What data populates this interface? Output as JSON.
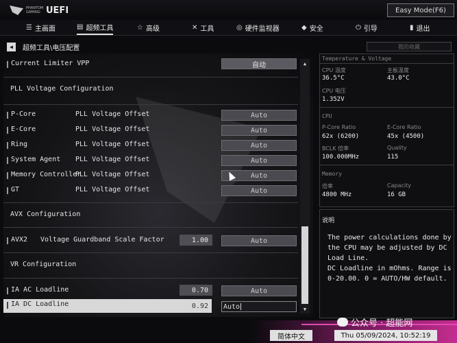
{
  "header": {
    "logo_small": "PHANTOM GAMING",
    "logo_big": "UEFI",
    "mode_button": "Easy Mode(F6)"
  },
  "nav": [
    {
      "icon": "☰",
      "label": "主画面"
    },
    {
      "icon": "▤",
      "label": "超频工具"
    },
    {
      "icon": "☆",
      "label": "高级"
    },
    {
      "icon": "✕",
      "label": "工具"
    },
    {
      "icon": "◎",
      "label": "硬件监视器"
    },
    {
      "icon": "◆",
      "label": "安全"
    },
    {
      "icon": "⏻",
      "label": "引导"
    },
    {
      "icon": "▮",
      "label": "退出"
    }
  ],
  "breadcrumb": "超频工具\\电压配置",
  "favorites": "我的收藏",
  "settings": {
    "current_limiter": {
      "label": "Current Limiter VPP",
      "value": "自动"
    },
    "pll_section": "PLL Voltage Configuration",
    "pll_rows": [
      {
        "label": "P-Core",
        "sub": "PLL Voltage Offset",
        "value": "Auto"
      },
      {
        "label": "E-Core",
        "sub": "PLL Voltage Offset",
        "value": "Auto"
      },
      {
        "label": "Ring",
        "sub": "PLL Voltage Offset",
        "value": "Auto"
      },
      {
        "label": "System Agent",
        "sub": "PLL Voltage Offset",
        "value": "Auto"
      },
      {
        "label": "Memory Controller",
        "sub": "PLL Voltage Offset",
        "value": "Auto"
      },
      {
        "label": "GT",
        "sub": "PLL Voltage Offset",
        "value": "Auto"
      }
    ],
    "avx_section": "AVX Configuration",
    "avx2": {
      "label": "AVX2",
      "sub": "Voltage Guardband Scale Factor",
      "number": "1.00",
      "value": "Auto"
    },
    "vr_section": "VR Configuration",
    "ia_ac": {
      "label": "IA AC Loadline",
      "number": "0.70",
      "value": "Auto"
    },
    "ia_dc": {
      "label": "IA DC Loadline",
      "number": "0.92",
      "value": "Auto"
    }
  },
  "info": {
    "temp_header": "Temperature & Voltage",
    "cpu_temp_label": "CPU 温度",
    "cpu_temp": "36.5°C",
    "mb_temp_label": "主板温度",
    "mb_temp": "43.0°C",
    "cpu_volt_label": "CPU 电压",
    "cpu_volt": "1.352V",
    "cpu_header": "CPU",
    "pcore_label": "P-Core Ratio",
    "pcore": "62x (6200)",
    "ecore_label": "E-Core Ratio",
    "ecore": "45x (4500)",
    "bclk_label": "BCLK 倍率",
    "bclk": "100.000MHz",
    "quality_label": "Quality",
    "quality": "115",
    "mem_header": "Memory",
    "mem_ratio_label": "倍率",
    "mem_ratio": "4800 MHz",
    "capacity_label": "Capacity",
    "capacity": "16 GB"
  },
  "help": {
    "title": "说明",
    "lines": [
      "The power calculations done by",
      "the CPU may be adjusted by DC",
      "Load Line.",
      "DC Loadline in mOhms. Range is",
      "0-20.00. 0 = AUTO/HW default."
    ]
  },
  "footer": {
    "language": "简体中文",
    "datetime": "Thu 05/09/2024, 10:52:19",
    "wechat": "公众号 · 超能网"
  },
  "colors": {
    "accent": "#c42d8f",
    "panel_bg": "#151518",
    "value_button": "#4a4a50"
  }
}
